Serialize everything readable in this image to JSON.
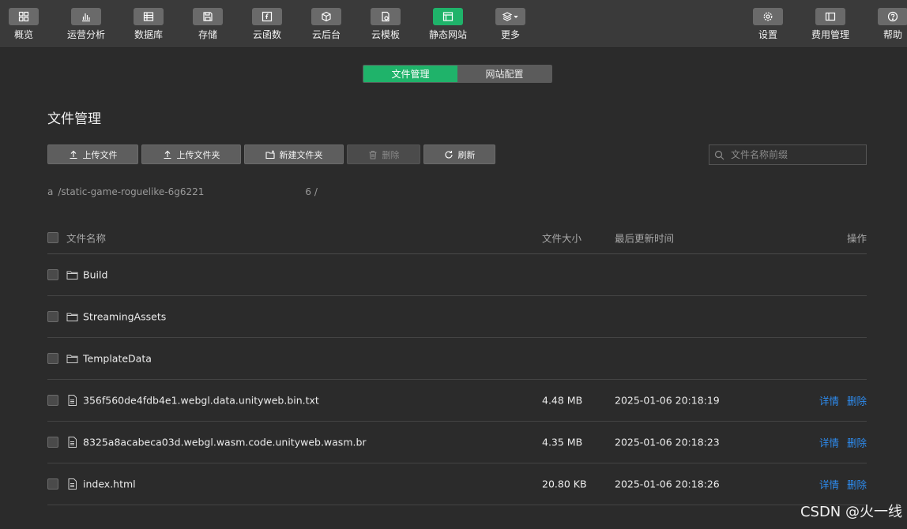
{
  "toolbar": {
    "items": [
      {
        "label": "概览",
        "icon": "dashboard-icon"
      },
      {
        "label": "运营分析",
        "icon": "bar-chart-icon"
      },
      {
        "label": "数据库",
        "icon": "database-icon"
      },
      {
        "label": "存储",
        "icon": "storage-icon"
      },
      {
        "label": "云函数",
        "icon": "function-icon"
      },
      {
        "label": "云后台",
        "icon": "cube-icon"
      },
      {
        "label": "云模板",
        "icon": "template-icon"
      },
      {
        "label": "静态网站",
        "icon": "website-icon"
      },
      {
        "label": "更多",
        "icon": "layers-icon"
      },
      {
        "label": "设置",
        "icon": "gear-icon"
      },
      {
        "label": "费用管理",
        "icon": "billing-icon"
      },
      {
        "label": "帮助",
        "icon": "help-icon"
      }
    ],
    "active": "静态网站"
  },
  "tabs": [
    {
      "label": "文件管理",
      "active": true
    },
    {
      "label": "网站配置",
      "active": false
    }
  ],
  "page_title": "文件管理",
  "actions": {
    "upload_file": "上传文件",
    "upload_folder": "上传文件夹",
    "new_folder": "新建文件夹",
    "delete": "删除",
    "refresh": "刷新"
  },
  "search": {
    "placeholder": "文件名称前缀"
  },
  "path": {
    "start": "a",
    "middle": "/static-game-roguelike-6g6221",
    "end": "6 /"
  },
  "table": {
    "headers": {
      "name": "文件名称",
      "size": "文件大小",
      "time": "最后更新时间",
      "ops": "操作"
    },
    "rows": [
      {
        "type": "folder",
        "name": "Build",
        "size": "",
        "time": ""
      },
      {
        "type": "folder",
        "name": "StreamingAssets",
        "size": "",
        "time": ""
      },
      {
        "type": "folder",
        "name": "TemplateData",
        "size": "",
        "time": ""
      },
      {
        "type": "file",
        "name": "356f560de4fdb4e1.webgl.data.unityweb.bin.txt",
        "size": "4.48 MB",
        "time": "2025-01-06 20:18:19",
        "detail": "详情",
        "delete": "删除"
      },
      {
        "type": "file",
        "name": "8325a8acabeca03d.webgl.wasm.code.unityweb.wasm.br",
        "size": "4.35 MB",
        "time": "2025-01-06 20:18:23",
        "detail": "详情",
        "delete": "删除"
      },
      {
        "type": "file",
        "name": "index.html",
        "size": "20.80 KB",
        "time": "2025-01-06 20:18:26",
        "detail": "详情",
        "delete": "删除"
      }
    ]
  },
  "watermark": "CSDN @火一线"
}
